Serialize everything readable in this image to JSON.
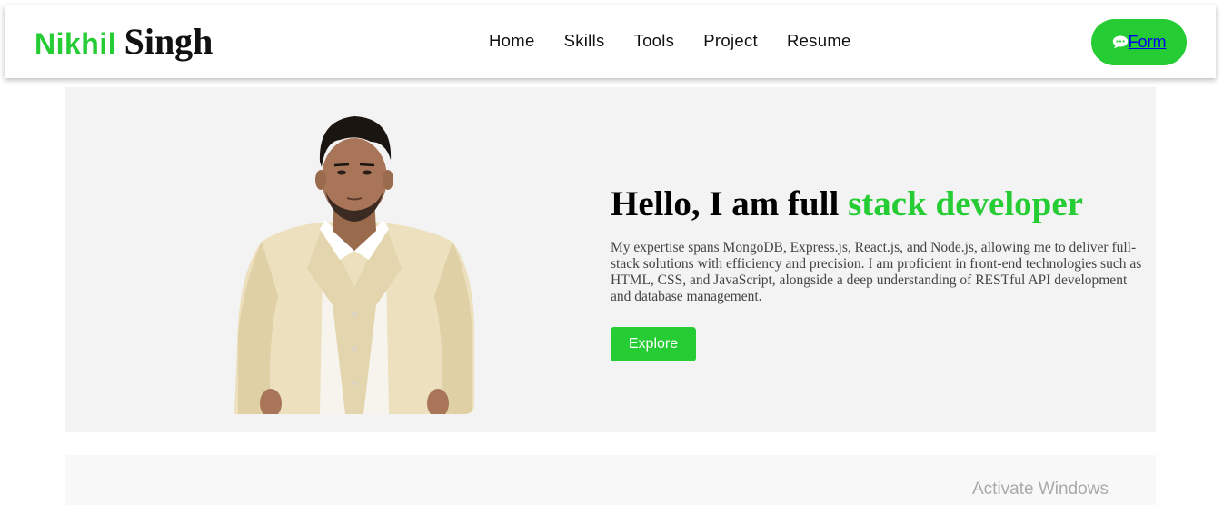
{
  "colors": {
    "accent": "#25cc34",
    "heading": "#000000",
    "body_text": "#444444",
    "hero_bg": "#f3f3f3",
    "link": "#0000ee"
  },
  "header": {
    "brand_first": "Nikhil",
    "brand_last": "Singh",
    "nav": [
      {
        "label": "Home"
      },
      {
        "label": "Skills"
      },
      {
        "label": "Tools"
      },
      {
        "label": "Project"
      },
      {
        "label": "Resume"
      }
    ],
    "form_button": {
      "icon": "chat-bubble-icon",
      "label": "Form"
    }
  },
  "hero": {
    "title_prefix": "Hello, I am full",
    "title_accent": "stack developer",
    "description": "My expertise spans MongoDB, Express.js, React.js, and Node.js, allowing me to deliver full-stack solutions with efficiency and precision. I am proficient in front-end technologies such as HTML, CSS, and JavaScript, alongside a deep understanding of RESTful API development and database management.",
    "button_label": "Explore"
  },
  "overlay": {
    "watermark": "Activate Windows"
  }
}
